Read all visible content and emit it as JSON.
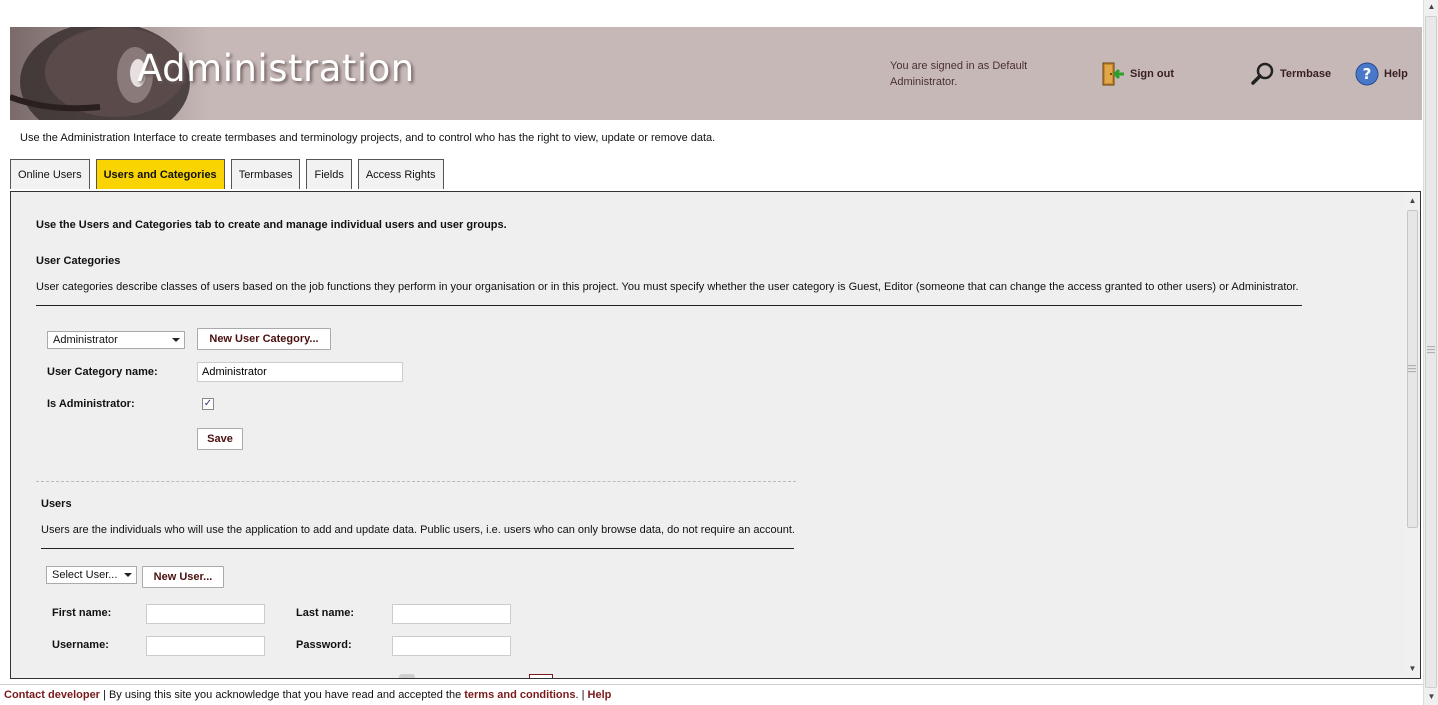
{
  "header": {
    "title": "Administration",
    "signed_in": "You are signed in as Default Administrator.",
    "signout_label": "Sign out",
    "termbase_label": "Termbase",
    "help_label": "Help"
  },
  "intro": "Use the Administration Interface to create termbases and terminology projects, and to control who has the right to view, update or remove data.",
  "tabs": [
    {
      "label": "Online Users"
    },
    {
      "label": "Users and Categories"
    },
    {
      "label": "Termbases"
    },
    {
      "label": "Fields"
    },
    {
      "label": "Access Rights"
    }
  ],
  "active_tab": "Users and Categories",
  "panel": {
    "lead": "Use the Users and Categories tab to create and manage individual users and user groups.",
    "categories": {
      "heading": "User Categories",
      "description": "User categories describe classes of users based on the job functions they perform in your organisation or in this project. You must specify whether the user category is Guest, Editor (someone that can change the access granted to other users) or Administrator.",
      "select_value": "Administrator",
      "new_button": "New User Category...",
      "name_label": "User Category name:",
      "name_value": "Administrator",
      "is_admin_label": "Is Administrator:",
      "is_admin_checked": true,
      "save_button": "Save"
    },
    "users": {
      "heading": "Users",
      "description": "Users are the individuals who will use the application to add and update data. Public users, i.e. users who can only browse data, do not require an account.",
      "select_value": "Select User...",
      "new_button": "New User...",
      "first_name_label": "First name:",
      "last_name_label": "Last name:",
      "username_label": "Username:",
      "password_label": "Password:",
      "first_name_value": "",
      "last_name_value": "",
      "username_value": "",
      "password_value": ""
    }
  },
  "footer": {
    "contact": "Contact developer",
    "sep1": " | ",
    "text": "By using this site you acknowledge that you have read and accepted the ",
    "terms": "terms and conditions",
    "sep2": ". | ",
    "help": "Help"
  },
  "colors": {
    "banner": "#c7b8b8",
    "active_tab": "#f9d400",
    "panel": "#efefef",
    "link": "#7a1a1a"
  }
}
